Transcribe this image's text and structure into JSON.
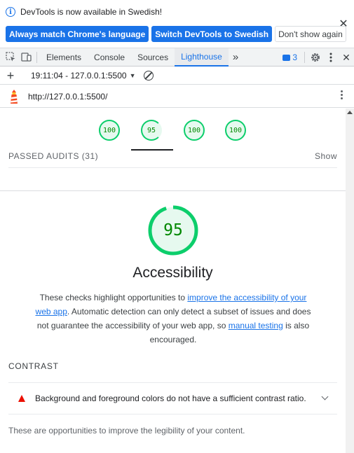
{
  "infobar": {
    "message": "DevTools is now available in Swedish!",
    "buttons": [
      "Always match Chrome's language",
      "Switch DevTools to Swedish",
      "Don't show again"
    ],
    "close_symbol": "✕"
  },
  "tabbar": {
    "tabs": [
      "Elements",
      "Console",
      "Sources",
      "Lighthouse"
    ],
    "active_tab": "Lighthouse",
    "more_symbol": "»",
    "issues_count": "3",
    "close_symbol": "✕"
  },
  "toolbar": {
    "add_symbol": "+",
    "report_label": "19:11:04 - 127.0.0.1:5500",
    "caret": "▼"
  },
  "urlbar": {
    "url": "http://127.0.0.1:5500/"
  },
  "scores": [
    "100",
    "95",
    "100",
    "100"
  ],
  "passed_audits_label": "PASSED AUDITS (31)",
  "show_label": "Show",
  "category": {
    "score": "95",
    "title": "Accessibility",
    "desc_1": "These checks highlight opportunities to ",
    "link_1": "improve the accessibility of your web app",
    "desc_2": ". Automatic detection can only detect a subset of issues and does not guarantee the accessibility of your web app, so ",
    "link_2": "manual testing",
    "desc_3": " is also encouraged."
  },
  "group": {
    "title": "CONTRAST",
    "audit": "Background and foreground colors do not have a sufficient contrast ratio.",
    "description": "These are opportunities to improve the legibility of your content."
  },
  "colors": {
    "pass": "#0cce6b",
    "fail": "#eb0f00",
    "link": "#1a73e8"
  }
}
